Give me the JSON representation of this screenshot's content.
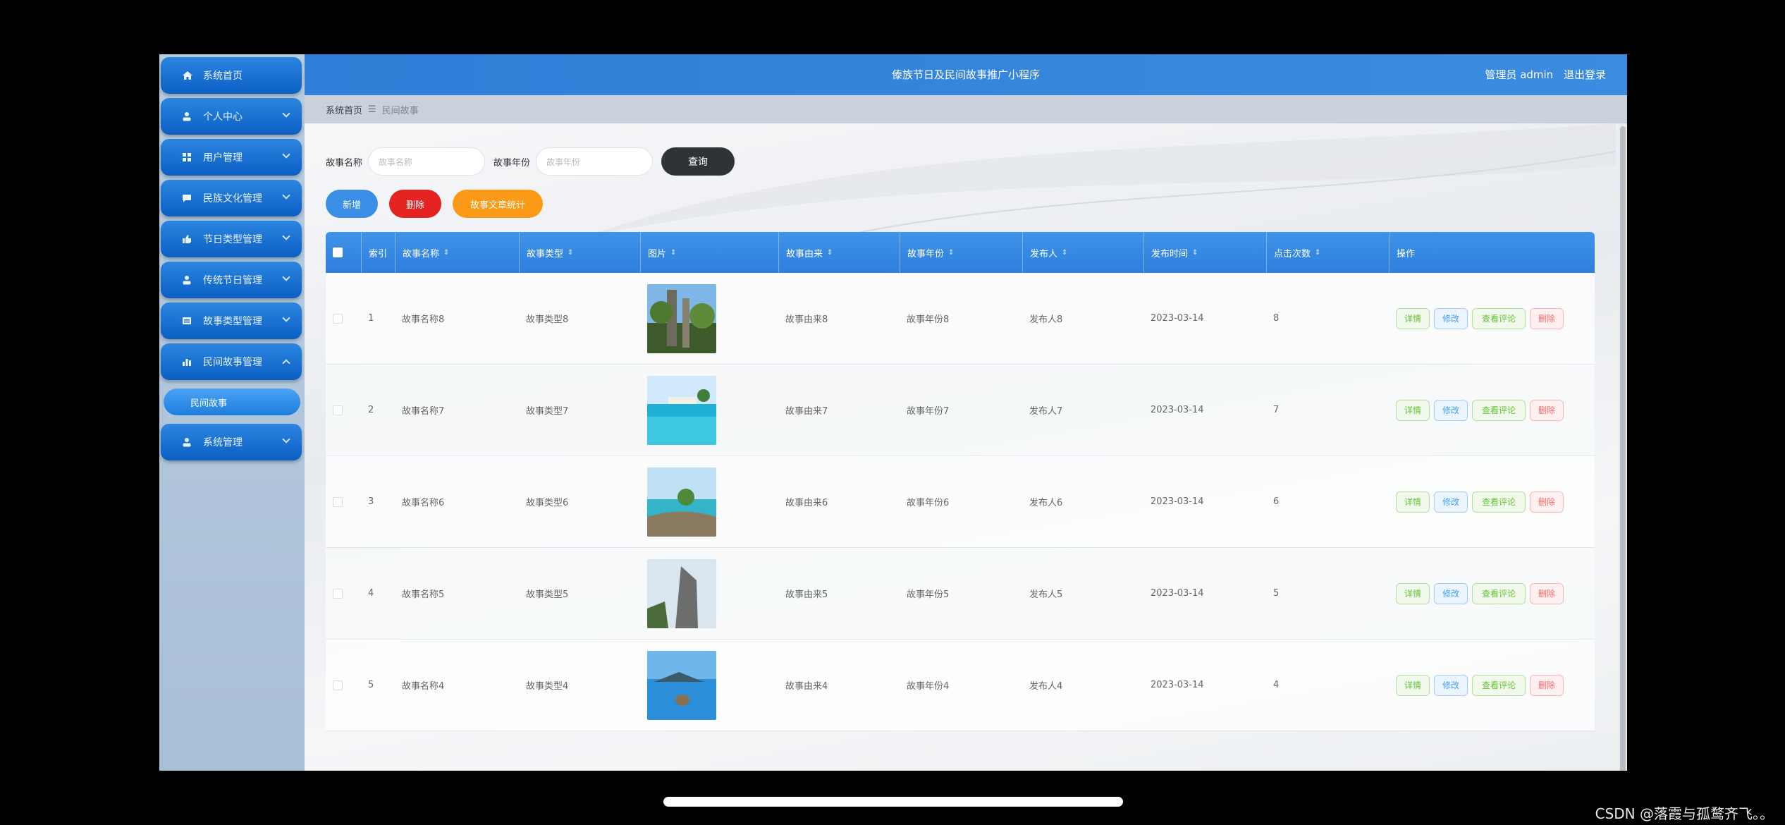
{
  "sidebar": {
    "items": [
      {
        "label": "系统首页",
        "icon": "home-icon"
      },
      {
        "label": "个人中心",
        "icon": "user-icon"
      },
      {
        "label": "用户管理",
        "icon": "grid-icon"
      },
      {
        "label": "民族文化管理",
        "icon": "chat-icon"
      },
      {
        "label": "节日类型管理",
        "icon": "thumb-icon"
      },
      {
        "label": "传统节日管理",
        "icon": "user-icon"
      },
      {
        "label": "故事类型管理",
        "icon": "list-icon"
      },
      {
        "label": "民间故事管理",
        "icon": "bar-chart-icon"
      },
      {
        "label": "系统管理",
        "icon": "user-icon"
      }
    ],
    "submenu": {
      "label": "民间故事"
    }
  },
  "header": {
    "title": "傣族节日及民间故事推广小程序",
    "user_label": "管理员 admin",
    "logout_label": "退出登录"
  },
  "breadcrumb": {
    "home": "系统首页",
    "current": "民间故事"
  },
  "search": {
    "name_label": "故事名称",
    "name_placeholder": "故事名称",
    "year_label": "故事年份",
    "year_placeholder": "故事年份",
    "query_label": "查询"
  },
  "actions": {
    "add_label": "新增",
    "delete_label": "删除",
    "stats_label": "故事文章统计"
  },
  "table": {
    "headers": [
      "索引",
      "故事名称",
      "故事类型",
      "图片",
      "故事由来",
      "故事年份",
      "发布人",
      "发布时间",
      "点击次数",
      "操作"
    ],
    "op_labels": {
      "detail": "详情",
      "edit": "修改",
      "comments": "查看评论",
      "delete": "删除"
    },
    "rows": [
      {
        "index": "1",
        "name": "故事名称8",
        "type": "故事类型8",
        "origin": "故事由来8",
        "year": "故事年份8",
        "publisher": "发布人8",
        "time": "2023-03-14",
        "clicks": "8",
        "img": "img-forest"
      },
      {
        "index": "2",
        "name": "故事名称7",
        "type": "故事类型7",
        "origin": "故事由来7",
        "year": "故事年份7",
        "publisher": "发布人7",
        "time": "2023-03-14",
        "clicks": "7",
        "img": "img-beach"
      },
      {
        "index": "3",
        "name": "故事名称6",
        "type": "故事类型6",
        "origin": "故事由来6",
        "year": "故事年份6",
        "publisher": "发布人6",
        "time": "2023-03-14",
        "clicks": "6",
        "img": "img-boat"
      },
      {
        "index": "4",
        "name": "故事名称5",
        "type": "故事类型5",
        "origin": "故事由来5",
        "year": "故事年份5",
        "publisher": "发布人5",
        "time": "2023-03-14",
        "clicks": "5",
        "img": "img-cliff"
      },
      {
        "index": "5",
        "name": "故事名称4",
        "type": "故事类型4",
        "origin": "故事由来4",
        "year": "故事年份4",
        "publisher": "发布人4",
        "time": "2023-03-14",
        "clicks": "4",
        "img": "img-lake"
      }
    ]
  },
  "watermark": "CSDN @落霞与孤鹜齐飞。。"
}
